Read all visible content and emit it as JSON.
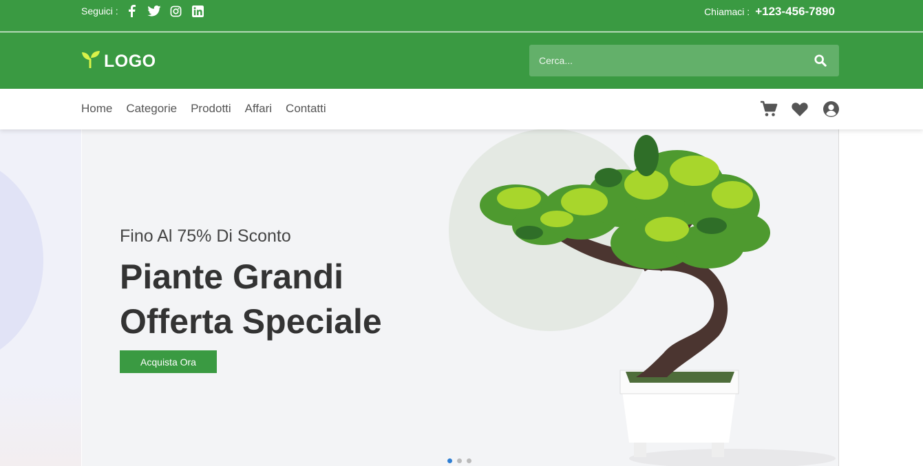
{
  "topbar": {
    "follow_label": "Seguici :",
    "social": [
      {
        "icon": "facebook-icon"
      },
      {
        "icon": "twitter-icon"
      },
      {
        "icon": "instagram-icon"
      },
      {
        "icon": "linkedin-icon"
      }
    ],
    "call_label": "Chiamaci :",
    "phone": "+123-456-7890"
  },
  "header": {
    "logo_text": "LOGO",
    "logo_icon": "sprout-icon",
    "search_placeholder": "Cerca...",
    "search_icon": "search-icon"
  },
  "nav": {
    "items": [
      "Home",
      "Categorie",
      "Prodotti",
      "Affari",
      "Contatti"
    ],
    "icons": [
      "cart-icon",
      "heart-icon",
      "user-icon"
    ]
  },
  "hero": {
    "discount": "Fino Al 75% Di Sconto",
    "title_line1": "Piante Grandi",
    "title_line2": "Offerta Speciale",
    "button": "Acquista Ora",
    "slides": 3,
    "active_slide": 1
  },
  "colors": {
    "brand_green": "#3a9a42",
    "search_bg": "#63b06a",
    "logo_accent": "#d9f24a",
    "dot_active": "#2f7fd4"
  }
}
